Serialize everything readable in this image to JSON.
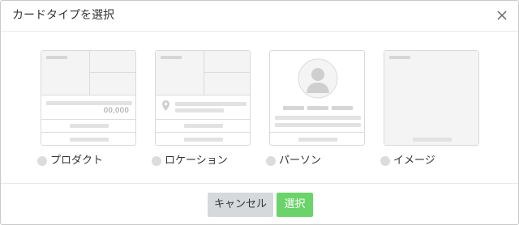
{
  "dialog": {
    "title": "カードタイプを選択",
    "close_icon": "close-icon"
  },
  "cards": [
    {
      "id": "product",
      "label": "プロダクト",
      "price": "00,000"
    },
    {
      "id": "location",
      "label": "ロケーション",
      "icon": "location-pin-icon"
    },
    {
      "id": "person",
      "label": "パーソン",
      "icon": "avatar-icon"
    },
    {
      "id": "image",
      "label": "イメージ"
    }
  ],
  "footer": {
    "cancel_label": "キャンセル",
    "select_label": "選択"
  },
  "colors": {
    "select_button": "#6ad46a",
    "cancel_button": "#d5d9dc"
  }
}
